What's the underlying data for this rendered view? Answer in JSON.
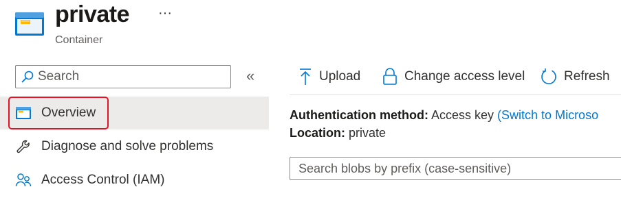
{
  "header": {
    "title": "private",
    "subtitle": "Container",
    "more_label": "···",
    "icon": "container-icon"
  },
  "sidebar": {
    "search": {
      "placeholder": "Search",
      "value": ""
    },
    "collapse_label": "«",
    "items": [
      {
        "label": "Overview",
        "icon": "container-icon",
        "selected": true
      },
      {
        "label": "Diagnose and solve problems",
        "icon": "wrench-icon",
        "selected": false
      },
      {
        "label": "Access Control (IAM)",
        "icon": "people-icon",
        "selected": false
      }
    ]
  },
  "toolbar": {
    "upload_label": "Upload",
    "change_access_label": "Change access level",
    "refresh_label": "Refresh"
  },
  "properties": {
    "auth_key": "Authentication method:",
    "auth_value": "Access key",
    "auth_link": "(Switch to Microso",
    "location_key": "Location:",
    "location_value": "private"
  },
  "blob_search": {
    "placeholder": "Search blobs by prefix (case-sensitive)",
    "value": ""
  },
  "colors": {
    "accent": "#0078d4",
    "highlight_border": "#e81123",
    "selected_bg": "#edebe9"
  }
}
